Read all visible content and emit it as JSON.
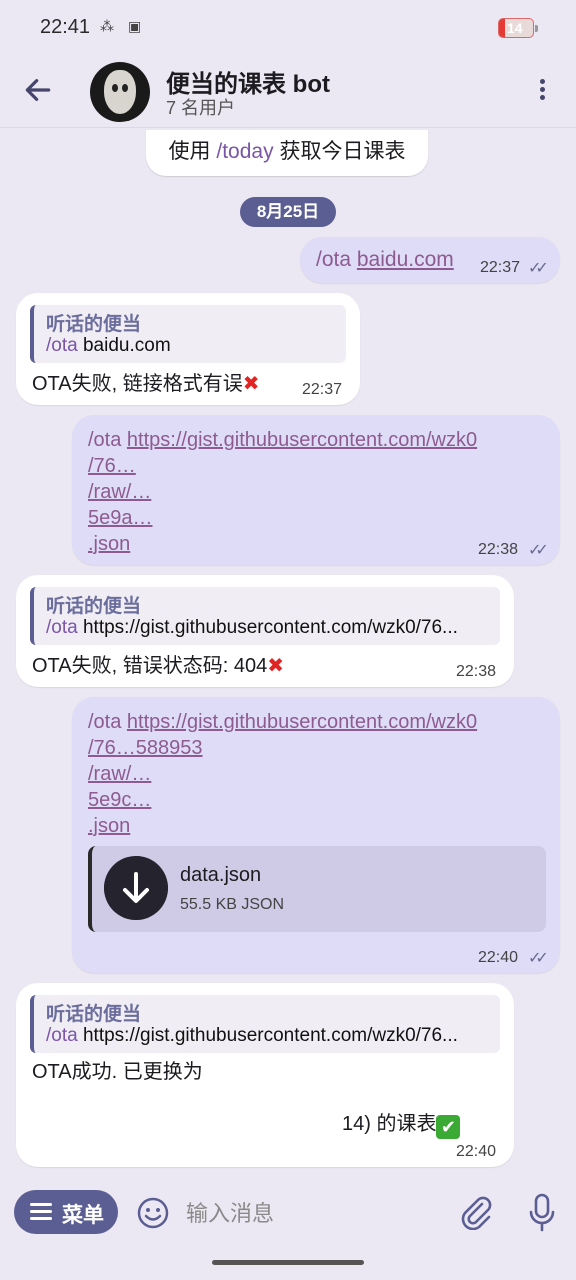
{
  "status": {
    "time": "22:41",
    "battery": "14"
  },
  "header": {
    "title": "便当的课表 bot",
    "subtitle": "7 名用户"
  },
  "pinned": {
    "prefix": "使用 ",
    "command": "/today",
    "suffix": " 获取今日课表"
  },
  "date_chip": "8月25日",
  "messages": {
    "m1": {
      "cmd": "/ota ",
      "link": "baidu.com",
      "time": "22:37"
    },
    "m2": {
      "reply_name": "听话的便当",
      "reply_cmd": "/ota",
      "reply_rest": " baidu.com",
      "text": "OTA失败, 链接格式有误",
      "time": "22:37"
    },
    "m3": {
      "cmd": "/ota ",
      "line1": "https://gist.githubusercontent.com/wzk0",
      "line2": "/76…",
      "line3": "/raw/…",
      "line4": "5e9a…",
      "line5": ".json",
      "time": "22:38"
    },
    "m4": {
      "reply_name": "听话的便当",
      "reply_cmd": "/ota",
      "reply_rest": " https://gist.githubusercontent.com/wzk0/76...",
      "text": "OTA失败, 错误状态码: 404",
      "time": "22:38"
    },
    "m5": {
      "cmd": "/ota ",
      "line1": "https://gist.githubusercontent.com/wzk0",
      "line2": "/76…588953",
      "line3": "/raw/…",
      "line4": "5e9c…",
      "line5": ".json",
      "file_name": "data.json",
      "file_size": "55.5 KB JSON",
      "time": "22:40"
    },
    "m6": {
      "reply_name": "听话的便当",
      "reply_cmd": "/ota",
      "reply_rest": " https://gist.githubusercontent.com/wzk0/76...",
      "text1": "OTA成功. 已更换为",
      "text2": "14) 的课表",
      "time": "22:40"
    }
  },
  "input": {
    "menu_label": "菜单",
    "placeholder": "输入消息"
  }
}
